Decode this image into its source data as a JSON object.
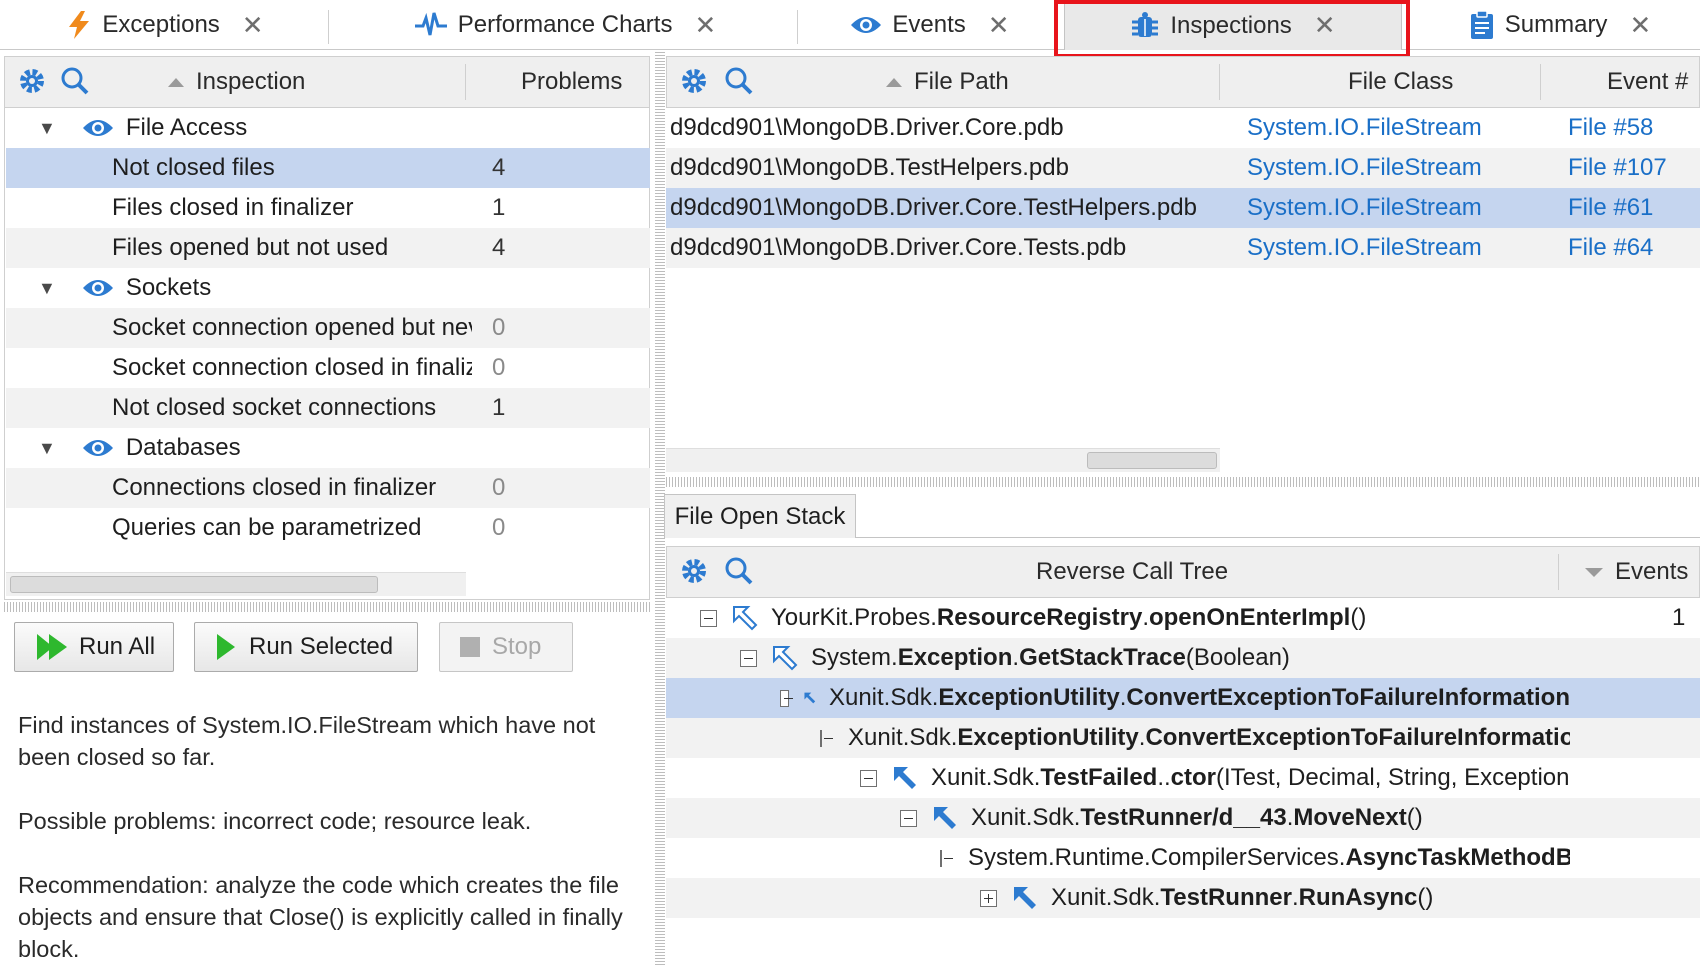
{
  "tabs": [
    {
      "label": "Exceptions",
      "icon": "lightning-icon"
    },
    {
      "label": "Performance Charts",
      "icon": "pulse-chart-icon"
    },
    {
      "label": "Events",
      "icon": "eye-icon"
    },
    {
      "label": "Inspections",
      "icon": "bug-icon",
      "active": true
    },
    {
      "label": "Summary",
      "icon": "clipboard-icon"
    }
  ],
  "inspection_panel": {
    "col_inspection": "Inspection",
    "col_problems": "Problems",
    "groups": [
      {
        "name": "File Access",
        "items": [
          {
            "label": "Not closed files",
            "count": "4"
          },
          {
            "label": "Files closed in finalizer",
            "count": "1"
          },
          {
            "label": "Files opened but not used",
            "count": "4"
          }
        ]
      },
      {
        "name": "Sockets",
        "items": [
          {
            "label": "Socket connection opened but never used",
            "count": "0"
          },
          {
            "label": "Socket connection closed in finalizer",
            "count": "0"
          },
          {
            "label": "Not closed socket connections",
            "count": "1"
          }
        ]
      },
      {
        "name": "Databases",
        "items": [
          {
            "label": "Connections closed in finalizer",
            "count": "0"
          },
          {
            "label": "Queries can be parametrized",
            "count": "0"
          }
        ]
      }
    ]
  },
  "buttons": {
    "run_all": "Run All",
    "run_selected": "Run Selected",
    "stop": "Stop"
  },
  "description": {
    "p1": "Find instances of System.IO.FileStream which have not been closed so far.",
    "p2": "Possible problems: incorrect code; resource leak.",
    "p3": "Recommendation: analyze the code which creates the file objects and ensure that Close() is explicitly called in finally block."
  },
  "file_table": {
    "col_path": "File Path",
    "col_class": "File Class",
    "col_event": "Event #",
    "rows": [
      {
        "path": "d9dcd901\\MongoDB.Driver.Core.pdb",
        "cls": "System.IO.FileStream",
        "event": "File #58"
      },
      {
        "path": "d9dcd901\\MongoDB.TestHelpers.pdb",
        "cls": "System.IO.FileStream",
        "event": "File #107"
      },
      {
        "path": "d9dcd901\\MongoDB.Driver.Core.TestHelpers.pdb",
        "cls": "System.IO.FileStream",
        "event": "File #61"
      },
      {
        "path": "d9dcd901\\MongoDB.Driver.Core.Tests.pdb",
        "cls": "System.IO.FileStream",
        "event": "File #64"
      }
    ]
  },
  "stack": {
    "tab_label": "File Open Stack",
    "col_tree": "Reverse Call Tree",
    "col_events": "Events",
    "nodes": [
      {
        "ns": "YourKit.Probes.",
        "cls": "ResourceRegistry",
        "dot": ".",
        "method": "openOnEnterImpl",
        "args": "()",
        "events": "1"
      },
      {
        "ns": "System.",
        "cls": "Exception",
        "dot": ".",
        "method": "GetStackTrace",
        "args": "(Boolean)",
        "events": ""
      },
      {
        "ns": "Xunit.Sdk.",
        "cls": "ExceptionUtility",
        "dot": ".",
        "method": "ConvertExceptionToFailureInformation",
        "args": "",
        "events": ""
      },
      {
        "ns": "Xunit.Sdk.",
        "cls": "ExceptionUtility",
        "dot": ".",
        "method": "ConvertExceptionToFailureInformation",
        "args": "",
        "events": ""
      },
      {
        "ns": "Xunit.Sdk.",
        "cls": "TestFailed",
        "dot": "..",
        "method": "ctor",
        "args": "(ITest, Decimal, String, Exception",
        "events": ""
      },
      {
        "ns": "Xunit.Sdk.",
        "cls": "TestRunner/d__43",
        "dot": ".",
        "method": "MoveNext",
        "args": "()",
        "events": ""
      },
      {
        "ns": "System.Runtime.CompilerServices.",
        "cls": "AsyncTaskMethodBuilder",
        "dot": "",
        "method": "",
        "args": "",
        "events": ""
      },
      {
        "ns": "Xunit.Sdk.",
        "cls": "TestRunner",
        "dot": ".",
        "method": "RunAsync",
        "args": "()",
        "events": ""
      }
    ]
  },
  "colors": {
    "accent": "#1a6fc7",
    "selection": "#c5d5ef",
    "highlight": "#e8141b"
  }
}
